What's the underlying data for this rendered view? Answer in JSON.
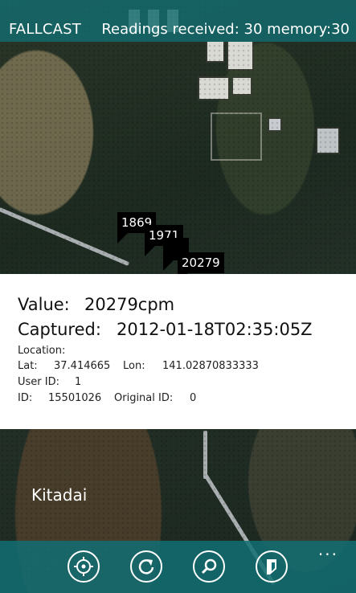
{
  "header": {
    "app_title": "FALLCAST",
    "readings_text": "Readings received: 30 memory:30"
  },
  "markers": [
    "1869",
    "1971",
    "20279"
  ],
  "details": {
    "value_label": "Value:",
    "value": "20279cpm",
    "captured_label": "Captured:",
    "captured": "2012-01-18T02:35:05Z",
    "location_label": "Location:",
    "lat_label": "Lat:",
    "lat": "37.414665",
    "lon_label": "Lon:",
    "lon": "141.02870833333",
    "user_id_label": "User ID:",
    "user_id": "1",
    "id_label": "ID:",
    "id": "15501026",
    "original_id_label": "Original ID:",
    "original_id": "0"
  },
  "map": {
    "place_label": "Kitadai"
  },
  "appbar": {
    "buttons": [
      "locate-icon",
      "refresh-icon",
      "search-icon",
      "filter-icon"
    ],
    "more": "..."
  },
  "colors": {
    "accent": "#126e73"
  }
}
